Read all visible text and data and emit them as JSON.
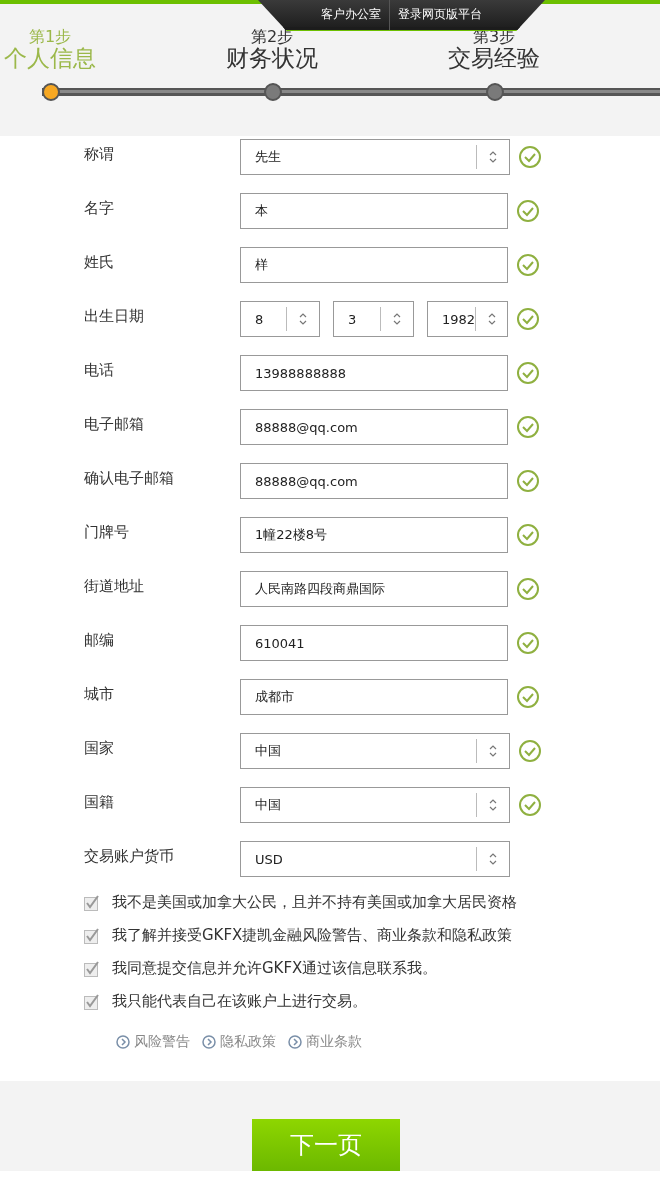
{
  "top_nav": [
    "客户办公室",
    "登录网页版平台"
  ],
  "steps": [
    {
      "step": "第1步",
      "title": "个人信息",
      "selected": true
    },
    {
      "step": "第2步",
      "title": "财务状况",
      "selected": false
    },
    {
      "step": "第3步",
      "title": "交易经验",
      "selected": false
    }
  ],
  "fields": [
    {
      "kind": "select",
      "label": "称谓",
      "value": "先生",
      "valid": true
    },
    {
      "kind": "text",
      "label": "名字",
      "value": "本",
      "valid": true
    },
    {
      "kind": "text",
      "label": "姓氏",
      "value": "样",
      "valid": true
    },
    {
      "kind": "date",
      "label": "出生日期",
      "parts": [
        "8",
        "3",
        "1982"
      ],
      "valid": true
    },
    {
      "kind": "text",
      "label": "电话",
      "value": "13988888888",
      "valid": true
    },
    {
      "kind": "text",
      "label": "电子邮箱",
      "value": "88888@qq.com",
      "valid": true
    },
    {
      "kind": "text",
      "label": "确认电子邮箱",
      "value": "88888@qq.com",
      "valid": true
    },
    {
      "kind": "text",
      "label": "门牌号",
      "value": "1幢22楼8号",
      "valid": true
    },
    {
      "kind": "text",
      "label": "街道地址",
      "value": "人民南路四段商鼎国际",
      "valid": true
    },
    {
      "kind": "text",
      "label": "邮编",
      "value": "610041",
      "valid": true
    },
    {
      "kind": "text",
      "label": "城市",
      "value": "成都市",
      "valid": true
    },
    {
      "kind": "select",
      "label": "国家",
      "value": "中国",
      "valid": true
    },
    {
      "kind": "select",
      "label": "国籍",
      "value": "中国",
      "valid": true
    },
    {
      "kind": "select",
      "label": "交易账户货币",
      "value": "USD",
      "valid": false
    }
  ],
  "agreements": [
    {
      "text": "我不是美国或加拿大公民，且并不持有美国或加拿大居民资格",
      "checked": true
    },
    {
      "text": "我了解并接受GKFX捷凯金融风险警告、商业条款和隐私政策",
      "checked": true
    },
    {
      "text": "我同意提交信息并允许GKFX通过该信息联系我。",
      "checked": true
    },
    {
      "text": "我只能代表自己在该账户上进行交易。",
      "checked": true
    }
  ],
  "links": [
    "风险警告",
    "隐私政策",
    "商业条款"
  ],
  "next_button": "下一页"
}
